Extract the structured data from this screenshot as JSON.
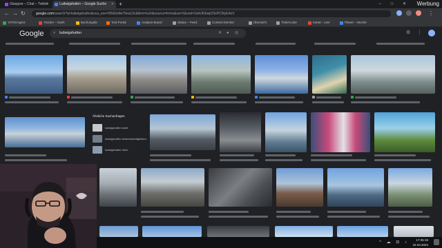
{
  "tabs": [
    {
      "label": "Glasgow – Chat – Twitch",
      "fav_color": "#9146ff",
      "active": false
    },
    {
      "label": "Ludwigshafen – Google Suche",
      "fav_color": "#4285f4",
      "active": true
    }
  ],
  "window": {
    "overlay_label": "Werbung",
    "controls": "– □ ✕"
  },
  "toolbar": {
    "back": "←",
    "forward": "→",
    "reload": "↻",
    "url_host": "google.com",
    "url_rest": "/search?q=ludwigshafen&sca_esv=5f0d2e8e79ea13c&tbm=isch&source=lnms&sa=X&ved=2ahUKEwjO3sPC5fyEAxV",
    "ext_icon": "ext-icon",
    "profile_icon": "profile-icon",
    "menu": "⋮"
  },
  "bookmarks": [
    {
      "label": "YOTE/Agent",
      "color": "#34a853"
    },
    {
      "label": "Tracker – Dash",
      "color": "#ea4335"
    },
    {
      "label": "Buchungsbr",
      "color": "#fbbc04"
    },
    {
      "label": "Tool-Portal",
      "color": "#ff6d00"
    },
    {
      "label": "Analyse-Board",
      "color": "#4285f4"
    },
    {
      "label": "Status – Feed",
      "color": "#9aa0a6"
    },
    {
      "label": "Content Monitor",
      "color": "#9aa0a6"
    },
    {
      "label": "Übersicht",
      "color": "#9aa0a6"
    },
    {
      "label": "Ticket-Liste",
      "color": "#9aa0a6"
    },
    {
      "label": "Kanal – Live",
      "color": "#ea4335"
    },
    {
      "label": "Planer – Woche",
      "color": "#4285f4"
    }
  ],
  "google": {
    "logo": "Google",
    "query": "ludwigshafen",
    "related_title": "Ähnliche Suchanfragen",
    "related": [
      {
        "text": "ludwigshafen karte",
        "color": "#c9c9c9"
      },
      {
        "text": "ludwigshafen sehenswürdigkeiten",
        "color": "#6f7d8c"
      },
      {
        "text": "ludwigshafen rhein",
        "color": "#8a9bb0"
      }
    ]
  },
  "taskbar": {
    "time": "17:35:19",
    "date": "22.03.2024",
    "tray": "^ ☁ ⊟ ♪"
  }
}
